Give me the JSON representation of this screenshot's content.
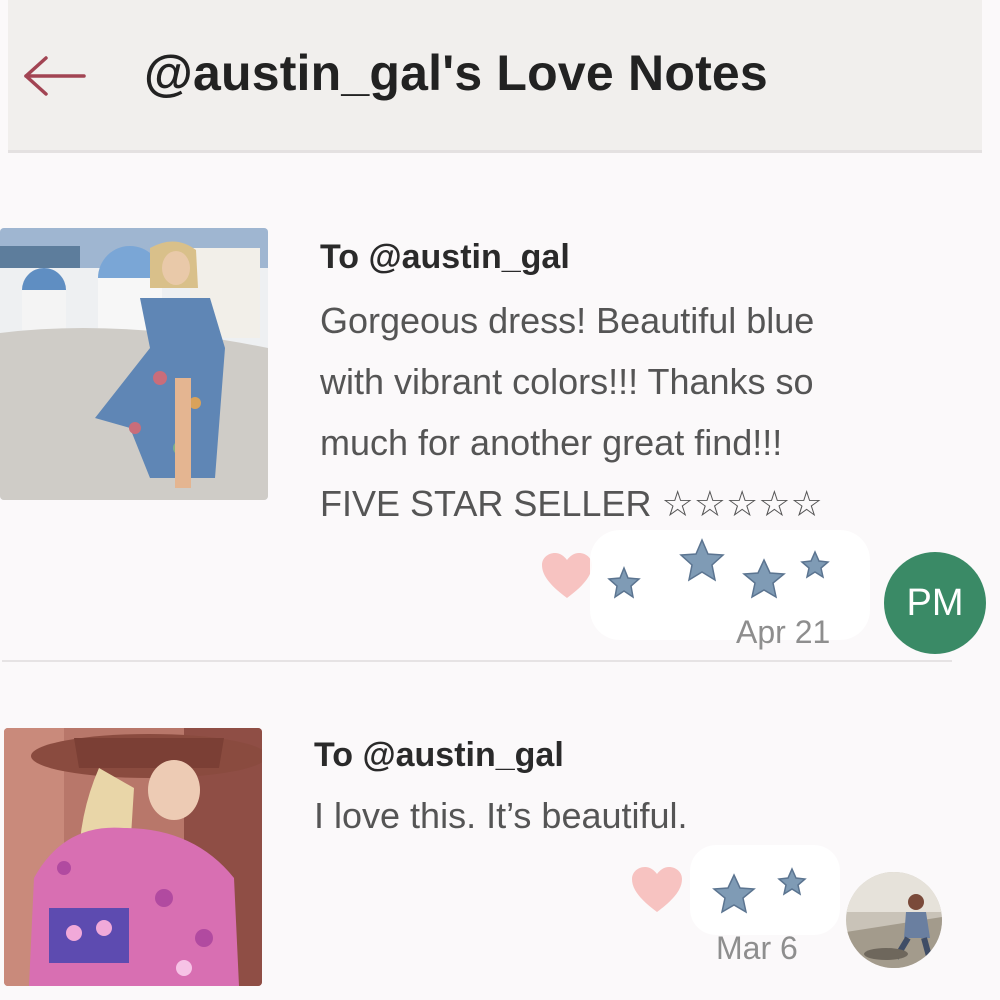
{
  "header": {
    "title": "@austin_gal's Love Notes",
    "back_icon": "arrow-left-icon"
  },
  "notes": [
    {
      "to": "To @austin_gal",
      "message": "Gorgeous dress! Beautiful blue\nwith vibrant colors!!! Thanks so\nmuch for another great find!!!\nFIVE STAR SELLER ☆☆☆☆☆",
      "date": "Apr 21",
      "avatar_initials": "PM",
      "avatar_color": "#3a8a66",
      "thumbnail": "woman-in-blue-floral-maxi-dress",
      "stamp_count": 4
    },
    {
      "to": "To @austin_gal",
      "message": "I love this. It’s beautiful.",
      "date": "Mar 6",
      "avatar": "photo-avatar",
      "thumbnail": "woman-in-pink-floral-kimono-and-hat",
      "stamp_count": 2
    }
  ],
  "colors": {
    "accent": "#a24453",
    "heart": "#f7c3c1",
    "header_bg": "#f1efed"
  }
}
